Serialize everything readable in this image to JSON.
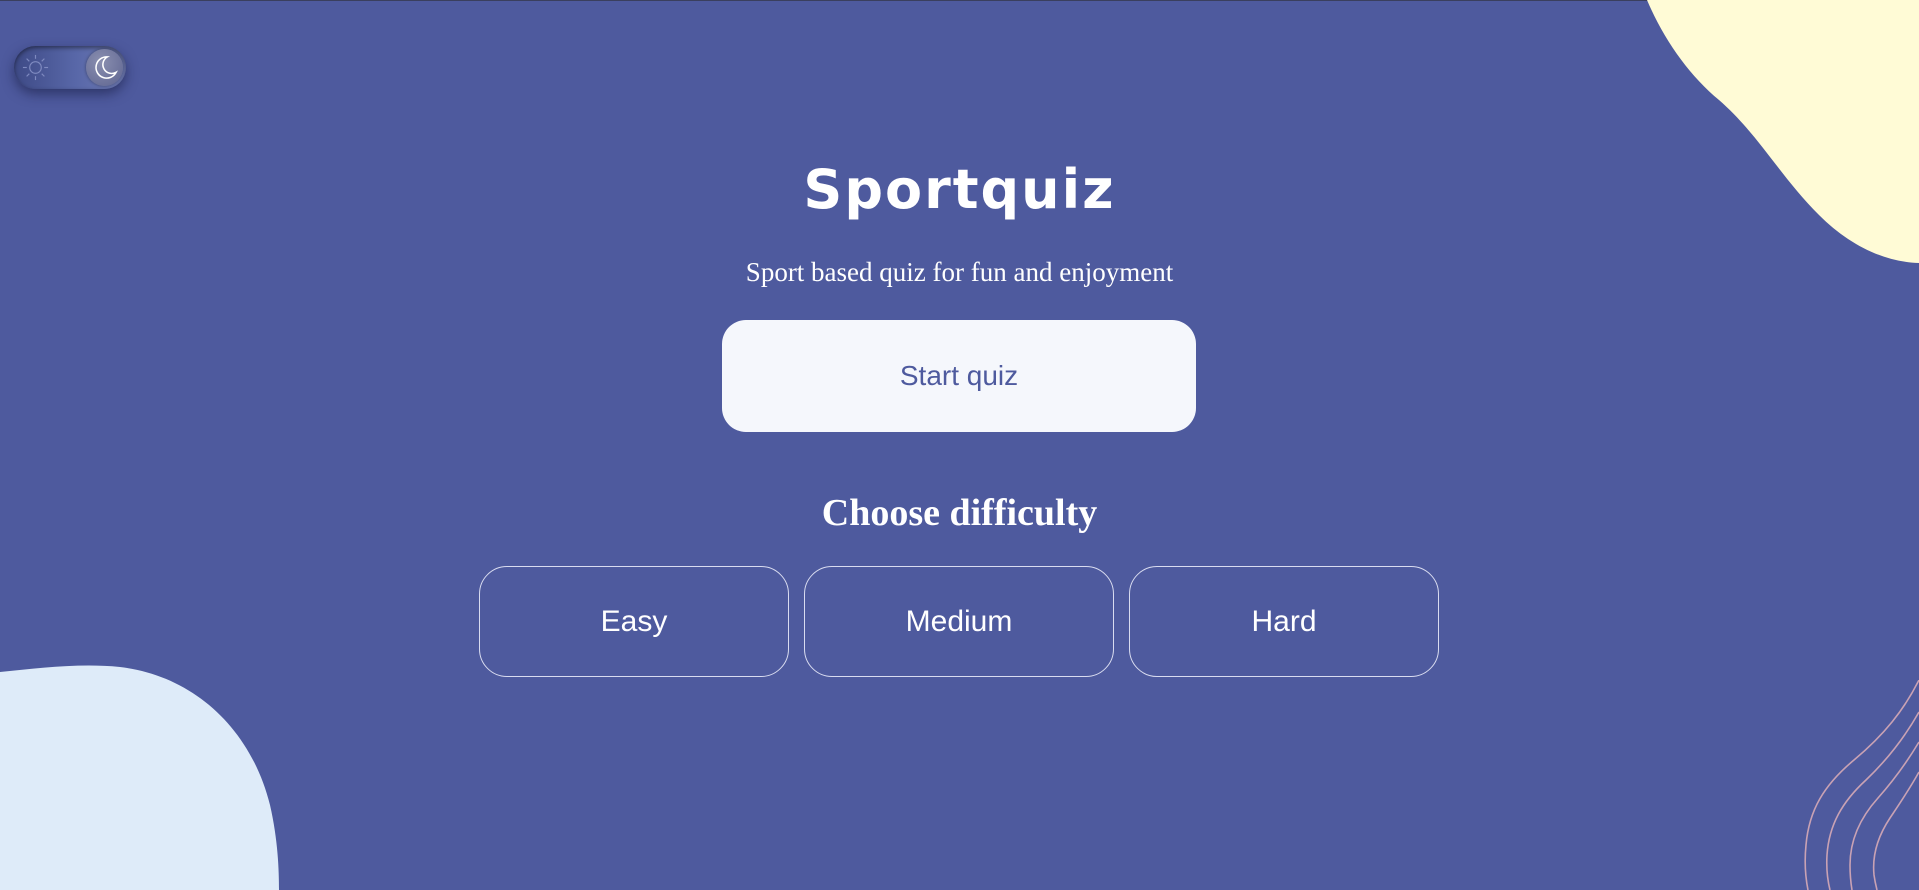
{
  "header": {
    "title": "Sportquiz",
    "subtitle": "Sport based quiz for fun and enjoyment"
  },
  "theme_toggle": {
    "mode": "dark",
    "icons": [
      "sun-icon",
      "moon-icon"
    ]
  },
  "actions": {
    "start_label": "Start quiz"
  },
  "difficulty": {
    "heading": "Choose difficulty",
    "options": [
      {
        "label": "Easy"
      },
      {
        "label": "Medium"
      },
      {
        "label": "Hard"
      }
    ]
  },
  "colors": {
    "background": "#4e5a9e",
    "start_button_bg": "#f5f7fc",
    "blob_top_right": "#fffbd6",
    "blob_bottom_left": "#deebf9",
    "lines": "#c9a2b4"
  }
}
